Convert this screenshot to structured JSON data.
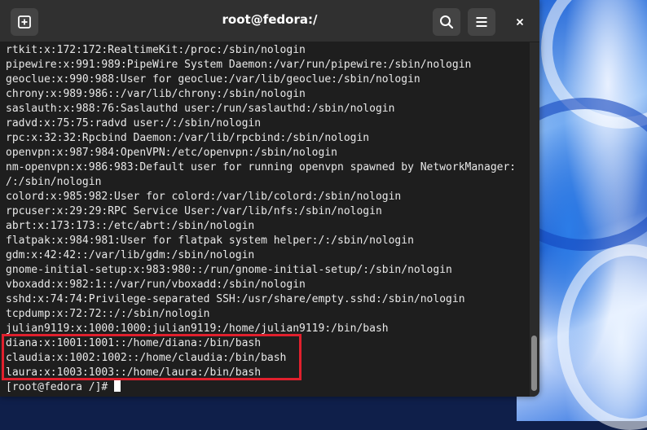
{
  "window": {
    "title": "root@fedora:/"
  },
  "terminal": {
    "lines": [
      "rtkit:x:172:172:RealtimeKit:/proc:/sbin/nologin",
      "pipewire:x:991:989:PipeWire System Daemon:/var/run/pipewire:/sbin/nologin",
      "geoclue:x:990:988:User for geoclue:/var/lib/geoclue:/sbin/nologin",
      "chrony:x:989:986::/var/lib/chrony:/sbin/nologin",
      "saslauth:x:988:76:Saslauthd user:/run/saslauthd:/sbin/nologin",
      "radvd:x:75:75:radvd user:/:/sbin/nologin",
      "rpc:x:32:32:Rpcbind Daemon:/var/lib/rpcbind:/sbin/nologin",
      "openvpn:x:987:984:OpenVPN:/etc/openvpn:/sbin/nologin",
      "nm-openvpn:x:986:983:Default user for running openvpn spawned by NetworkManager:",
      "/:/sbin/nologin",
      "colord:x:985:982:User for colord:/var/lib/colord:/sbin/nologin",
      "rpcuser:x:29:29:RPC Service User:/var/lib/nfs:/sbin/nologin",
      "abrt:x:173:173::/etc/abrt:/sbin/nologin",
      "flatpak:x:984:981:User for flatpak system helper:/:/sbin/nologin",
      "gdm:x:42:42::/var/lib/gdm:/sbin/nologin",
      "gnome-initial-setup:x:983:980::/run/gnome-initial-setup/:/sbin/nologin",
      "vboxadd:x:982:1::/var/run/vboxadd:/sbin/nologin",
      "sshd:x:74:74:Privilege-separated SSH:/usr/share/empty.sshd:/sbin/nologin",
      "tcpdump:x:72:72::/:/sbin/nologin",
      "julian9119:x:1000:1000:julian9119:/home/julian9119:/bin/bash",
      "diana:x:1001:1001::/home/diana:/bin/bash",
      "claudia:x:1002:1002::/home/claudia:/bin/bash",
      "laura:x:1003:1003::/home/laura:/bin/bash"
    ],
    "prompt": "[root@fedora /]# "
  },
  "icons": {
    "new_tab": "new-tab-icon",
    "search": "search-icon",
    "menu": "hamburger-menu-icon",
    "close": "close-icon"
  },
  "colors": {
    "highlight_border": "#e0202d",
    "terminal_bg": "#1e1e1e",
    "headerbar_bg": "#303030"
  }
}
